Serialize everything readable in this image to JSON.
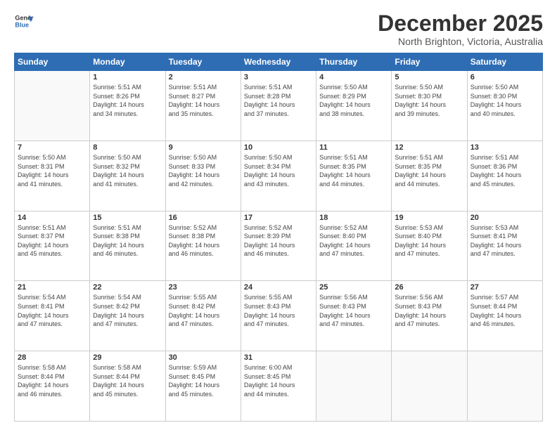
{
  "logo": {
    "line1": "General",
    "line2": "Blue"
  },
  "header": {
    "month": "December 2025",
    "location": "North Brighton, Victoria, Australia"
  },
  "weekdays": [
    "Sunday",
    "Monday",
    "Tuesday",
    "Wednesday",
    "Thursday",
    "Friday",
    "Saturday"
  ],
  "weeks": [
    [
      {
        "day": "",
        "info": ""
      },
      {
        "day": "1",
        "info": "Sunrise: 5:51 AM\nSunset: 8:26 PM\nDaylight: 14 hours\nand 34 minutes."
      },
      {
        "day": "2",
        "info": "Sunrise: 5:51 AM\nSunset: 8:27 PM\nDaylight: 14 hours\nand 35 minutes."
      },
      {
        "day": "3",
        "info": "Sunrise: 5:51 AM\nSunset: 8:28 PM\nDaylight: 14 hours\nand 37 minutes."
      },
      {
        "day": "4",
        "info": "Sunrise: 5:50 AM\nSunset: 8:29 PM\nDaylight: 14 hours\nand 38 minutes."
      },
      {
        "day": "5",
        "info": "Sunrise: 5:50 AM\nSunset: 8:30 PM\nDaylight: 14 hours\nand 39 minutes."
      },
      {
        "day": "6",
        "info": "Sunrise: 5:50 AM\nSunset: 8:30 PM\nDaylight: 14 hours\nand 40 minutes."
      }
    ],
    [
      {
        "day": "7",
        "info": "Sunrise: 5:50 AM\nSunset: 8:31 PM\nDaylight: 14 hours\nand 41 minutes."
      },
      {
        "day": "8",
        "info": "Sunrise: 5:50 AM\nSunset: 8:32 PM\nDaylight: 14 hours\nand 41 minutes."
      },
      {
        "day": "9",
        "info": "Sunrise: 5:50 AM\nSunset: 8:33 PM\nDaylight: 14 hours\nand 42 minutes."
      },
      {
        "day": "10",
        "info": "Sunrise: 5:50 AM\nSunset: 8:34 PM\nDaylight: 14 hours\nand 43 minutes."
      },
      {
        "day": "11",
        "info": "Sunrise: 5:51 AM\nSunset: 8:35 PM\nDaylight: 14 hours\nand 44 minutes."
      },
      {
        "day": "12",
        "info": "Sunrise: 5:51 AM\nSunset: 8:35 PM\nDaylight: 14 hours\nand 44 minutes."
      },
      {
        "day": "13",
        "info": "Sunrise: 5:51 AM\nSunset: 8:36 PM\nDaylight: 14 hours\nand 45 minutes."
      }
    ],
    [
      {
        "day": "14",
        "info": "Sunrise: 5:51 AM\nSunset: 8:37 PM\nDaylight: 14 hours\nand 45 minutes."
      },
      {
        "day": "15",
        "info": "Sunrise: 5:51 AM\nSunset: 8:38 PM\nDaylight: 14 hours\nand 46 minutes."
      },
      {
        "day": "16",
        "info": "Sunrise: 5:52 AM\nSunset: 8:38 PM\nDaylight: 14 hours\nand 46 minutes."
      },
      {
        "day": "17",
        "info": "Sunrise: 5:52 AM\nSunset: 8:39 PM\nDaylight: 14 hours\nand 46 minutes."
      },
      {
        "day": "18",
        "info": "Sunrise: 5:52 AM\nSunset: 8:40 PM\nDaylight: 14 hours\nand 47 minutes."
      },
      {
        "day": "19",
        "info": "Sunrise: 5:53 AM\nSunset: 8:40 PM\nDaylight: 14 hours\nand 47 minutes."
      },
      {
        "day": "20",
        "info": "Sunrise: 5:53 AM\nSunset: 8:41 PM\nDaylight: 14 hours\nand 47 minutes."
      }
    ],
    [
      {
        "day": "21",
        "info": "Sunrise: 5:54 AM\nSunset: 8:41 PM\nDaylight: 14 hours\nand 47 minutes."
      },
      {
        "day": "22",
        "info": "Sunrise: 5:54 AM\nSunset: 8:42 PM\nDaylight: 14 hours\nand 47 minutes."
      },
      {
        "day": "23",
        "info": "Sunrise: 5:55 AM\nSunset: 8:42 PM\nDaylight: 14 hours\nand 47 minutes."
      },
      {
        "day": "24",
        "info": "Sunrise: 5:55 AM\nSunset: 8:43 PM\nDaylight: 14 hours\nand 47 minutes."
      },
      {
        "day": "25",
        "info": "Sunrise: 5:56 AM\nSunset: 8:43 PM\nDaylight: 14 hours\nand 47 minutes."
      },
      {
        "day": "26",
        "info": "Sunrise: 5:56 AM\nSunset: 8:43 PM\nDaylight: 14 hours\nand 47 minutes."
      },
      {
        "day": "27",
        "info": "Sunrise: 5:57 AM\nSunset: 8:44 PM\nDaylight: 14 hours\nand 46 minutes."
      }
    ],
    [
      {
        "day": "28",
        "info": "Sunrise: 5:58 AM\nSunset: 8:44 PM\nDaylight: 14 hours\nand 46 minutes."
      },
      {
        "day": "29",
        "info": "Sunrise: 5:58 AM\nSunset: 8:44 PM\nDaylight: 14 hours\nand 45 minutes."
      },
      {
        "day": "30",
        "info": "Sunrise: 5:59 AM\nSunset: 8:45 PM\nDaylight: 14 hours\nand 45 minutes."
      },
      {
        "day": "31",
        "info": "Sunrise: 6:00 AM\nSunset: 8:45 PM\nDaylight: 14 hours\nand 44 minutes."
      },
      {
        "day": "",
        "info": ""
      },
      {
        "day": "",
        "info": ""
      },
      {
        "day": "",
        "info": ""
      }
    ]
  ]
}
